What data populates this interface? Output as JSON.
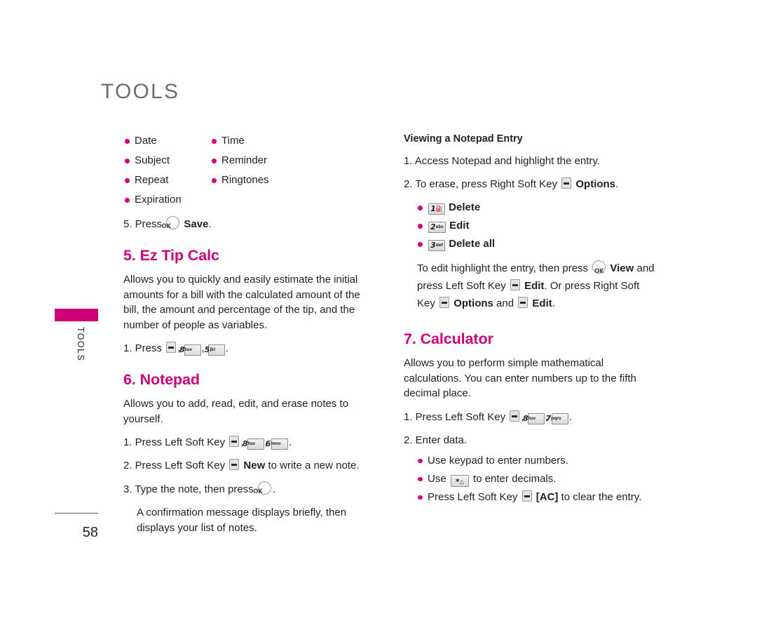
{
  "page": {
    "header": "TOOLS",
    "side_tab_label": "TOOLS",
    "folio": "58",
    "accent_color": "#cf0077",
    "bullet_color": "#d6007f",
    "header_color": "#6d6d6d"
  },
  "left_column": {
    "attributes": {
      "column_1": [
        "Date",
        "Subject",
        "Repeat",
        "Expiration"
      ],
      "column_2": [
        "Time",
        "Reminder",
        "Ringtones"
      ]
    },
    "step_5": {
      "prefix": "5. Press",
      "key_icon": "ok-key-icon",
      "key_label": "OK",
      "bold_text": "Save",
      "suffix": "."
    },
    "section_ez_tip": {
      "heading": "5. Ez Tip Calc",
      "body": "Allows you to quickly and easily estimate the initial amounts for a bill with the calculated amount of the bill, the amount and percentage of the tip, and the number of people as variables.",
      "step_1": {
        "prefix": "1. Press",
        "keys": [
          {
            "icon": "soft-key-icon"
          },
          {
            "digit": "8",
            "letters": "tuv"
          },
          {
            "digit": "5",
            "letters": "jkl"
          }
        ],
        "suffix": "."
      }
    },
    "section_notepad": {
      "heading": "6. Notepad",
      "body": "Allows you to add, read, edit, and erase notes to yourself.",
      "step_1": {
        "prefix": "1. Press Left Soft Key",
        "keys": [
          {
            "icon": "soft-key-icon"
          },
          {
            "digit": "8",
            "letters": "tuv"
          },
          {
            "digit": "6",
            "letters": "mno"
          }
        ],
        "suffix": "."
      },
      "step_2": {
        "prefix": "2. Press Left Soft Key",
        "key_icon": "soft-key-icon",
        "bold_text": "New",
        "suffix": "to write a new note."
      },
      "step_3": {
        "prefix": "3. Type the note, then press",
        "key_icon": "ok-key-icon",
        "key_label": "OK",
        "suffix": "."
      },
      "step_3_note": "A confirmation message displays briefly, then displays your list of notes."
    }
  },
  "right_column": {
    "section_viewing": {
      "heading": "Viewing a Notepad Entry",
      "step_1": "1. Access Notepad and highlight the entry.",
      "step_2": {
        "prefix": "2. To erase, press Right Soft Key",
        "key_icon": "soft-key-icon",
        "bold_text": "Options",
        "suffix": "."
      },
      "options": [
        {
          "digit": "1",
          "glyph": "voicemail-glyph",
          "label": "Delete"
        },
        {
          "digit": "2",
          "letters": "abc",
          "label": "Edit"
        },
        {
          "digit": "3",
          "letters": "def",
          "label": "Delete all"
        }
      ],
      "edit_note": {
        "part_1": "To edit highlight the entry, then press",
        "key_ok": "OK",
        "bold_1": "View",
        "part_2": "and press Left Soft Key",
        "bold_2": "Edit",
        "part_3": ". Or press Right Soft Key",
        "bold_3": "Options",
        "part_4": "and",
        "bold_4": "Edit",
        "part_5": "."
      }
    },
    "section_calculator": {
      "heading": "7. Calculator",
      "body": "Allows you to perform simple mathematical calculations. You can enter numbers up to the fifth decimal place.",
      "step_1": {
        "prefix": "1. Press Left Soft Key",
        "keys": [
          {
            "icon": "soft-key-icon"
          },
          {
            "digit": "8",
            "letters": "tuv"
          },
          {
            "digit": "7",
            "letters": "pqrs"
          }
        ],
        "suffix": "."
      },
      "step_2": "2. Enter data.",
      "step_2_bullets": {
        "bullet_1": "Use keypad to enter numbers.",
        "bullet_2": {
          "prefix": "Use",
          "key_icon": "star-key-icon",
          "key_digit": "*",
          "suffix": "to enter decimals."
        },
        "bullet_3": {
          "prefix": "Press Left Soft Key",
          "key_icon": "soft-key-icon",
          "bold_text": "[AC]",
          "suffix": "to clear the entry."
        }
      }
    }
  }
}
